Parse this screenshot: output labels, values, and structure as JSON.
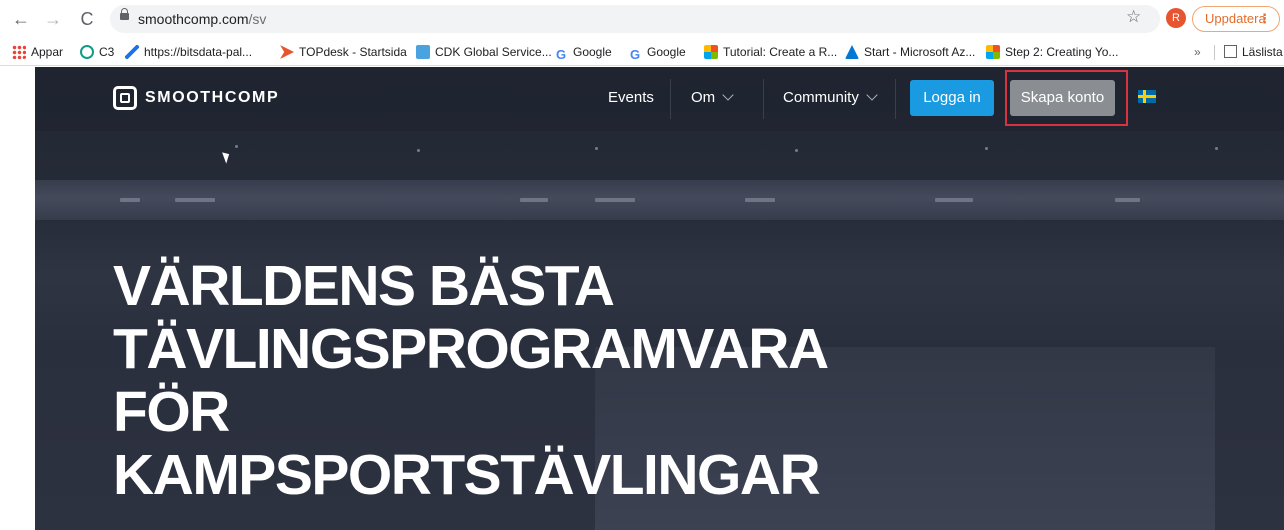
{
  "browser": {
    "url_host": "smoothcomp.com",
    "url_path": "/sv",
    "profile_initial": "R",
    "update_label": "Uppdatera",
    "bookmarks": [
      {
        "label": "Appar",
        "icon": "apps-grid-icon"
      },
      {
        "label": "C3",
        "icon": "c3-icon"
      },
      {
        "label": "https://bitsdata-pal...",
        "icon": "pen-icon"
      },
      {
        "label": "TOPdesk - Startsida",
        "icon": "topdesk-icon"
      },
      {
        "label": "CDK Global Service...",
        "icon": "cdk-icon"
      },
      {
        "label": "Google",
        "icon": "google-icon"
      },
      {
        "label": "Google",
        "icon": "google-icon"
      },
      {
        "label": "Tutorial: Create a R...",
        "icon": "microsoft-icon"
      },
      {
        "label": "Start - Microsoft Az...",
        "icon": "azure-icon"
      },
      {
        "label": "Step 2: Creating Yo...",
        "icon": "microsoft-icon"
      }
    ],
    "overflow_label": "»",
    "reading_list_label": "Läslista"
  },
  "site": {
    "logo_text": "SMOOTHCOMP",
    "nav": {
      "events": "Events",
      "om": "Om",
      "community": "Community",
      "login": "Logga in",
      "signup": "Skapa konto"
    },
    "hero_lines": [
      "VÄRLDENS BÄSTA",
      "TÄVLINGSPROGRAMVARA",
      "FÖR",
      "KAMPSPORTSTÄVLINGAR"
    ]
  },
  "colors": {
    "login_button": "#1a9ae0",
    "signup_button": "#8a8d92",
    "highlight": "#d9333f",
    "update_accent": "#e36c2b"
  }
}
